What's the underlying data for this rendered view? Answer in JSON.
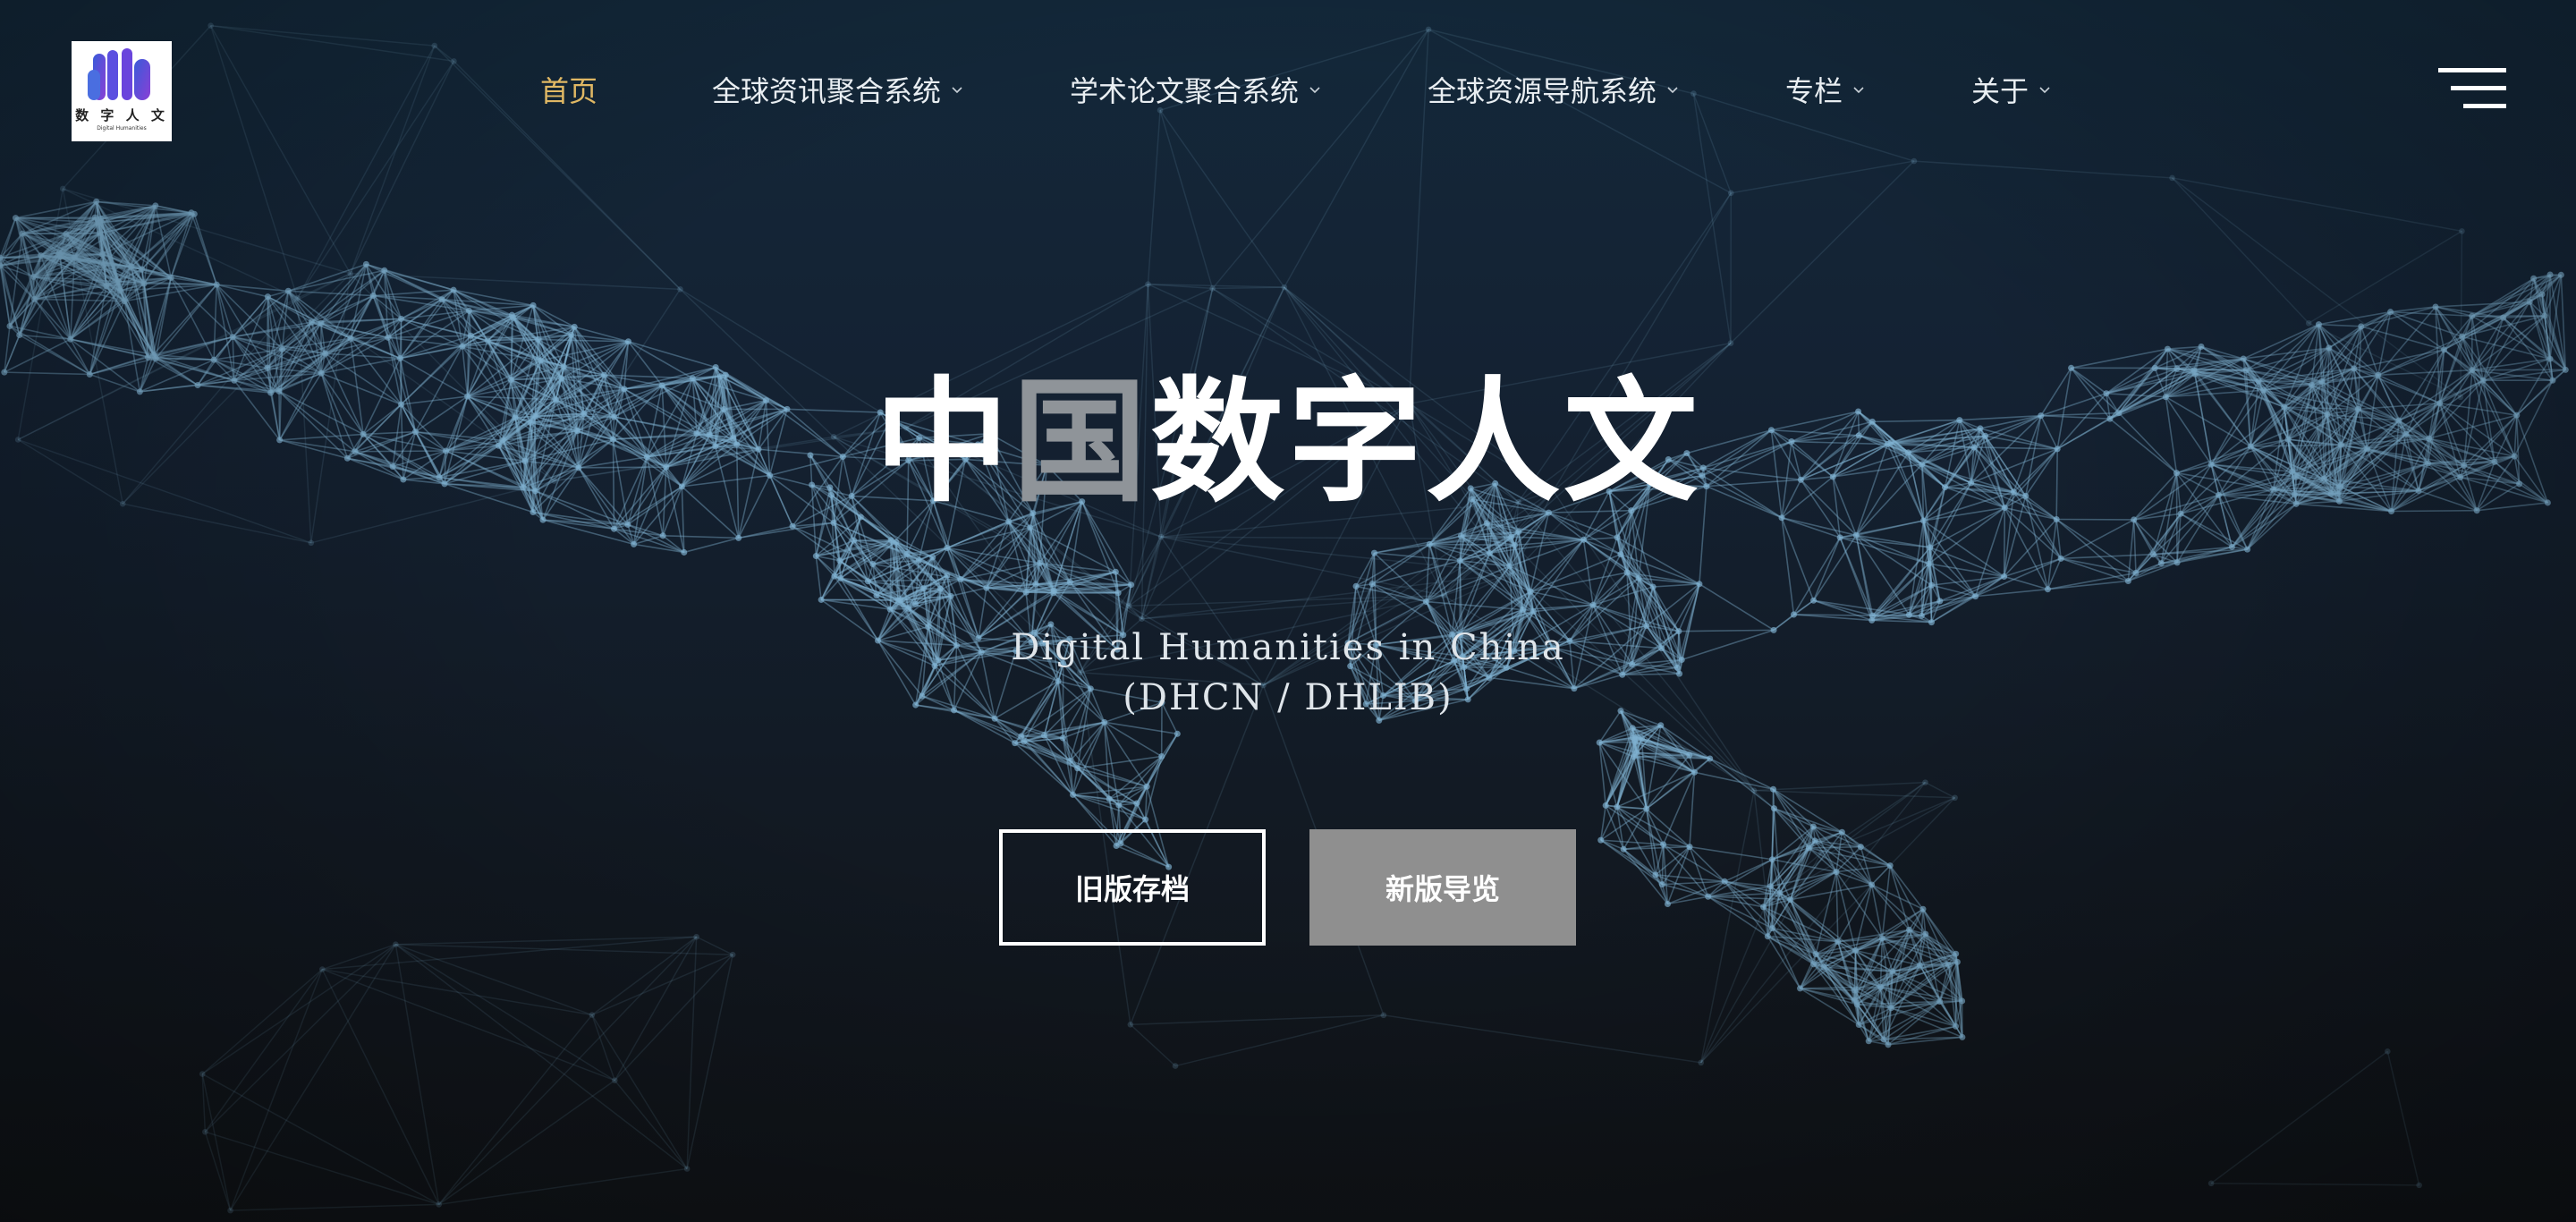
{
  "brand": {
    "logo_cn": "数 字 人 文",
    "logo_en": "Digital Humanities"
  },
  "nav": {
    "items": [
      {
        "label": "首页",
        "active": true,
        "has_dropdown": false
      },
      {
        "label": "全球资讯聚合系统",
        "active": false,
        "has_dropdown": true
      },
      {
        "label": "学术论文聚合系统",
        "active": false,
        "has_dropdown": true
      },
      {
        "label": "全球资源导航系统",
        "active": false,
        "has_dropdown": true
      },
      {
        "label": "专栏",
        "active": false,
        "has_dropdown": true
      },
      {
        "label": "关于",
        "active": false,
        "has_dropdown": true
      }
    ],
    "menu_icon": "hamburger-icon"
  },
  "hero": {
    "title_part1": "中",
    "title_part2": "国",
    "title_part3": "数字人文",
    "subtitle_line1": "Digital Humanities in China",
    "subtitle_line2": "(DHCN / DHLIB)",
    "button_old": "旧版存档",
    "button_new": "新版导览"
  },
  "colors": {
    "accent": "#e0b864",
    "background": "#13283a",
    "network_line": "#7fb0cf"
  }
}
